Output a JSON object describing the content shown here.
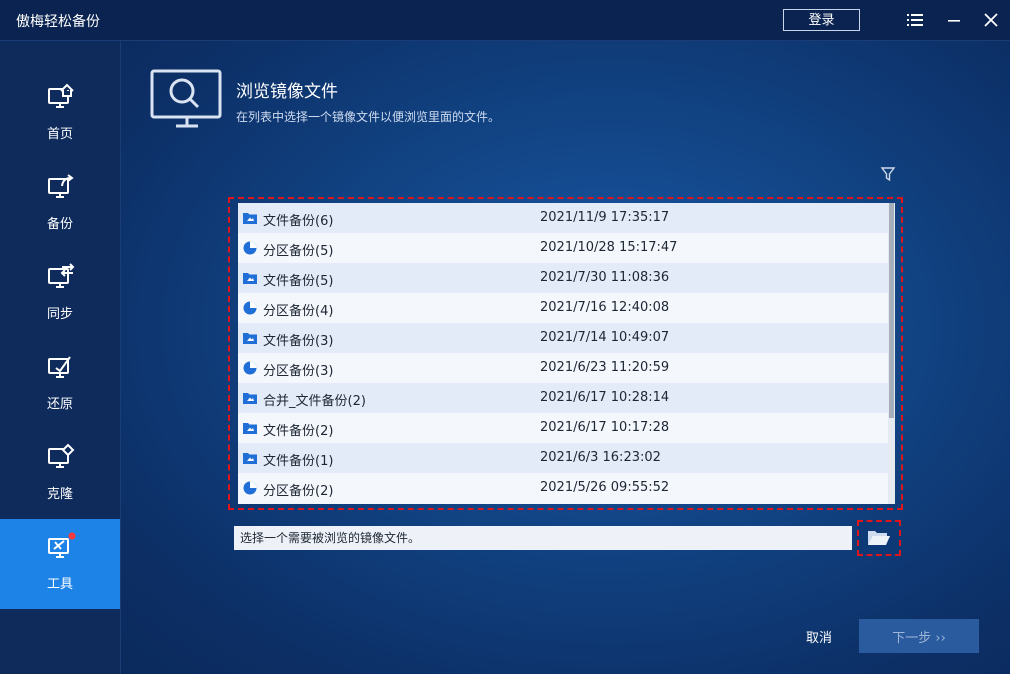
{
  "app": {
    "title": "傲梅轻松备份",
    "login_label": "登录"
  },
  "sidebar": {
    "items": [
      {
        "label": "首页",
        "icon": "home-monitor-icon"
      },
      {
        "label": "备份",
        "icon": "backup-monitor-icon"
      },
      {
        "label": "同步",
        "icon": "sync-monitor-icon"
      },
      {
        "label": "还原",
        "icon": "restore-monitor-icon"
      },
      {
        "label": "克隆",
        "icon": "clone-monitor-icon"
      },
      {
        "label": "工具",
        "icon": "tools-monitor-icon",
        "active": true
      }
    ]
  },
  "main": {
    "title": "浏览镜像文件",
    "subtitle": "在列表中选择一个镜像文件以便浏览里面的文件。",
    "rows": [
      {
        "name": "文件备份(6)",
        "date": "2021/11/9 17:35:17",
        "type": "file"
      },
      {
        "name": "分区备份(5)",
        "date": "2021/10/28 15:17:47",
        "type": "partition"
      },
      {
        "name": "文件备份(5)",
        "date": "2021/7/30 11:08:36",
        "type": "file"
      },
      {
        "name": "分区备份(4)",
        "date": "2021/7/16 12:40:08",
        "type": "partition"
      },
      {
        "name": "文件备份(3)",
        "date": "2021/7/14 10:49:07",
        "type": "file"
      },
      {
        "name": "分区备份(3)",
        "date": "2021/6/23 11:20:59",
        "type": "partition"
      },
      {
        "name": "合并_文件备份(2)",
        "date": "2021/6/17 10:28:14",
        "type": "file"
      },
      {
        "name": "文件备份(2)",
        "date": "2021/6/17 10:17:28",
        "type": "file"
      },
      {
        "name": "文件备份(1)",
        "date": "2021/6/3 16:23:02",
        "type": "file"
      },
      {
        "name": "分区备份(2)",
        "date": "2021/5/26 09:55:52",
        "type": "partition"
      }
    ],
    "path_placeholder": "选择一个需要被浏览的镜像文件。"
  },
  "footer": {
    "cancel_label": "取消",
    "next_label": "下一步 ››"
  },
  "colors": {
    "accent": "#1d83e6",
    "highlight_border": "#e0141b",
    "file_icon": "#1f6fd6"
  }
}
